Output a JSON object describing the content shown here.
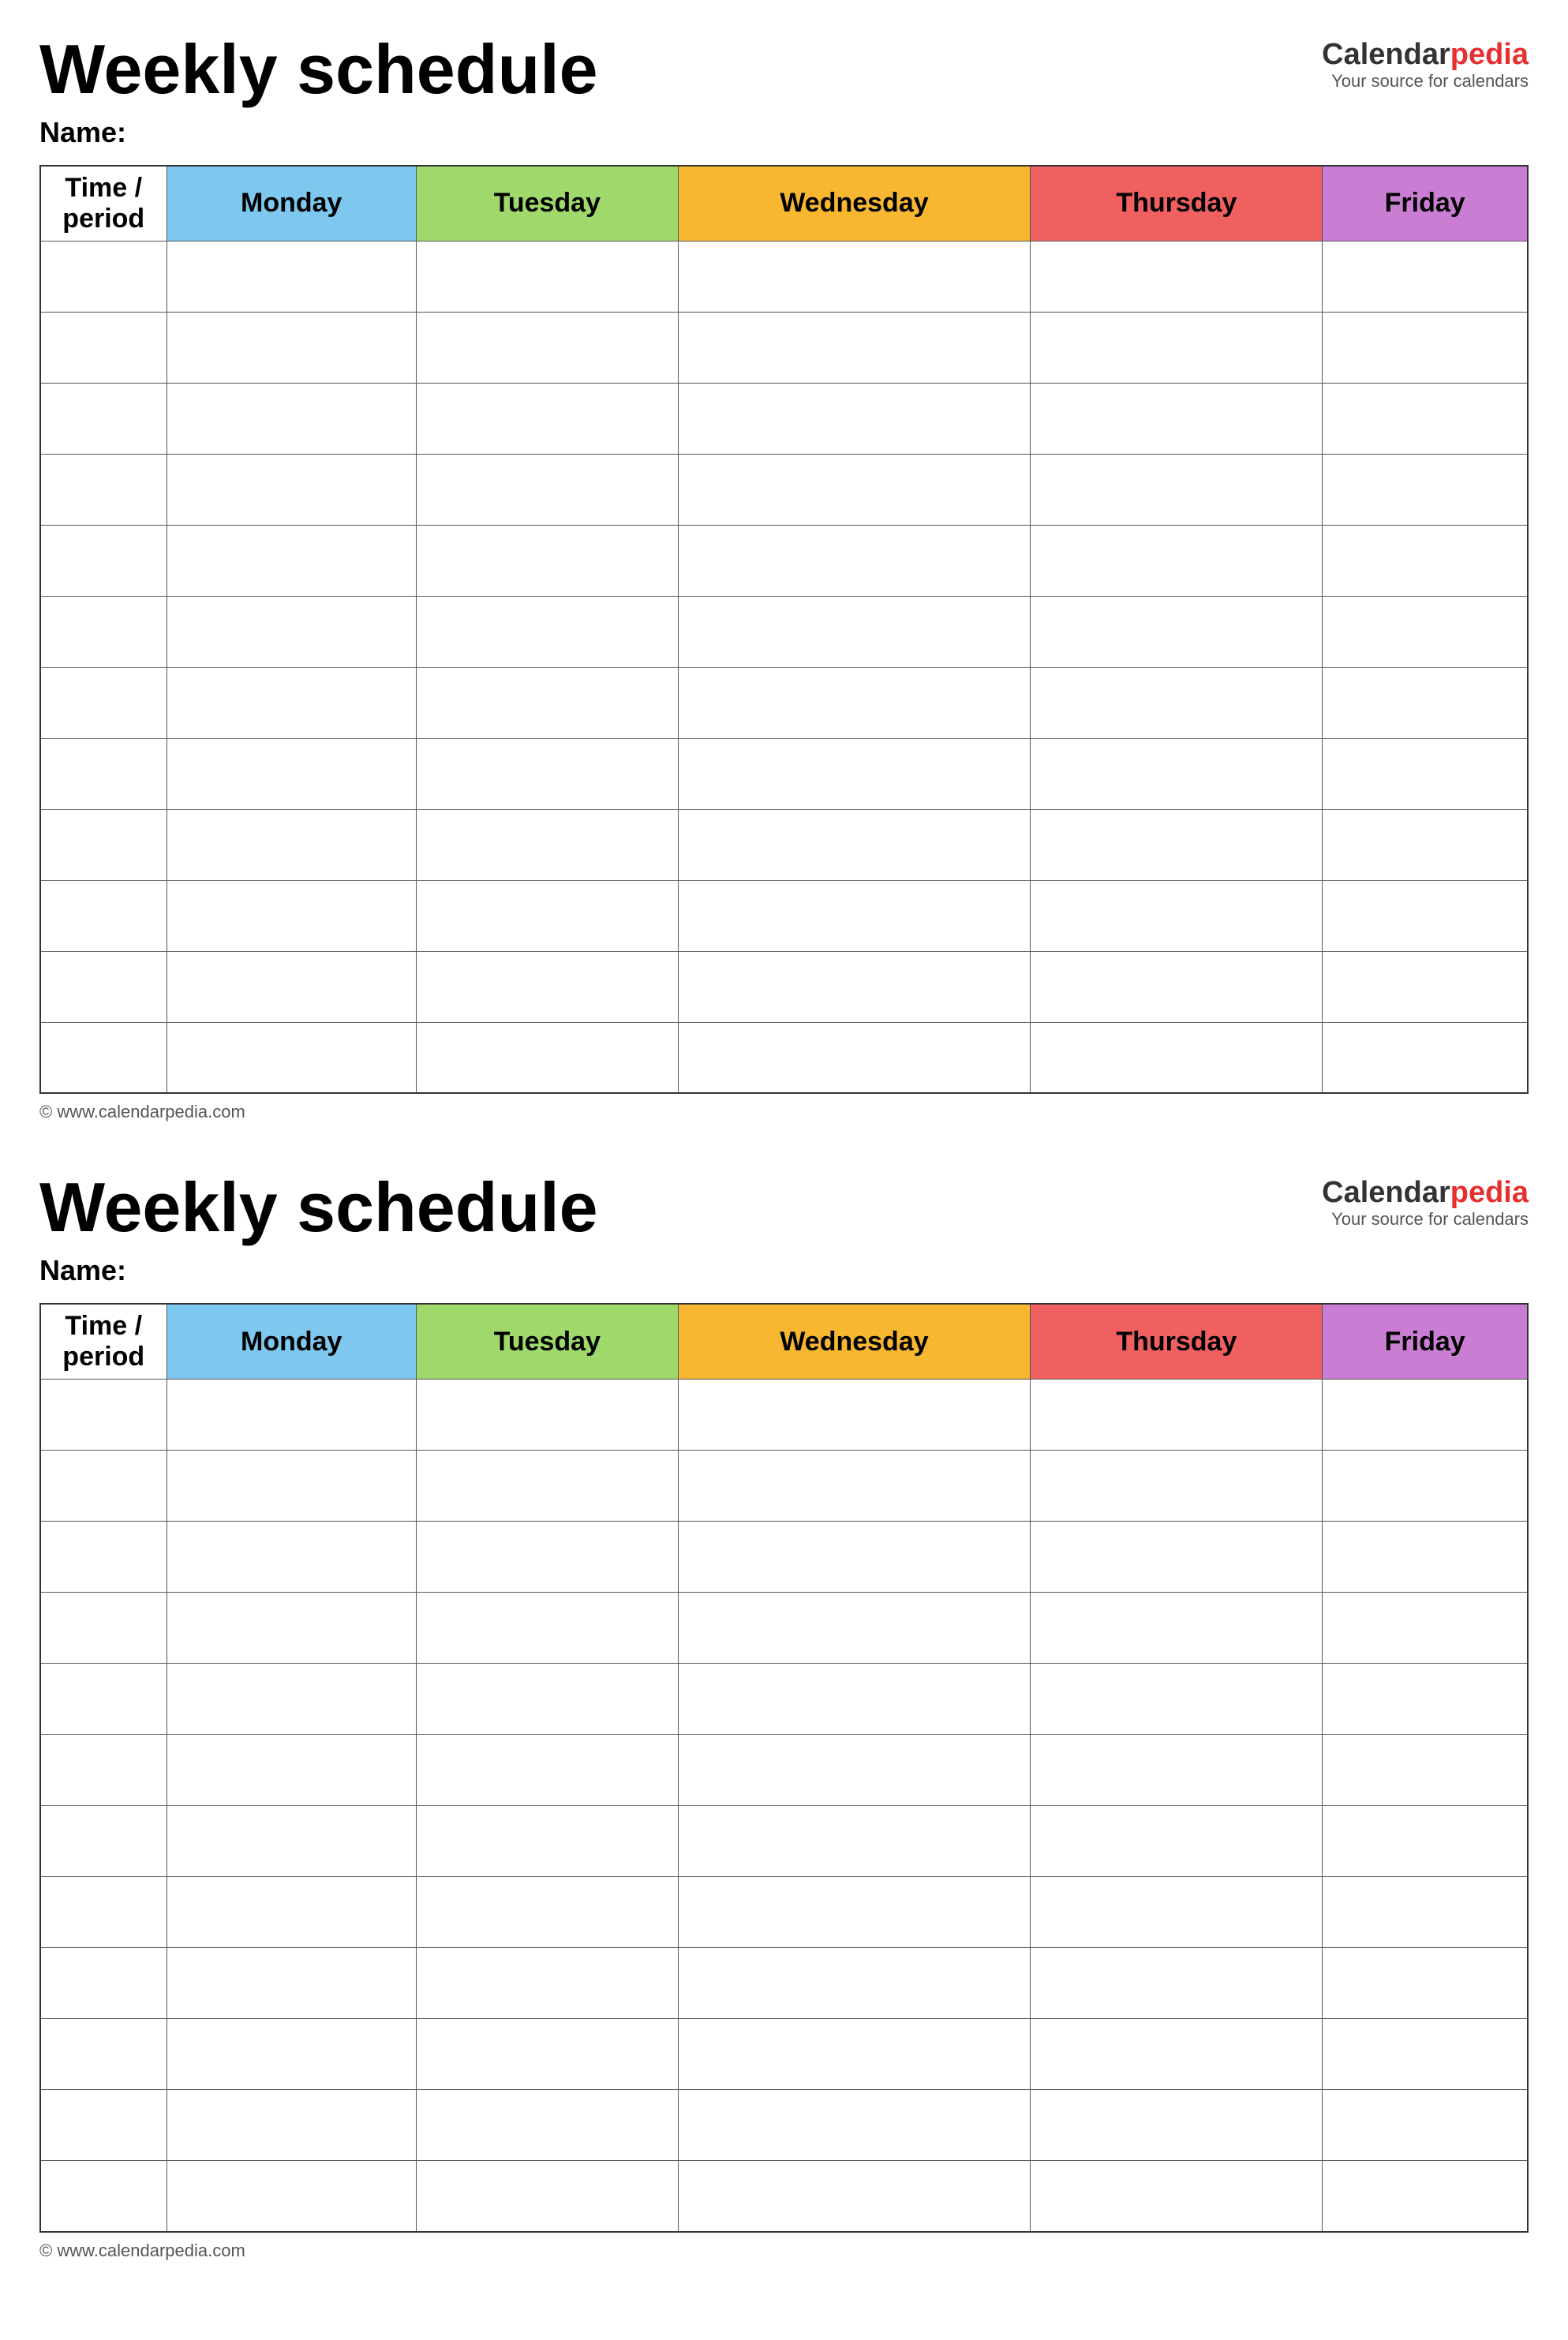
{
  "sections": [
    {
      "id": "section1",
      "title": "Weekly schedule",
      "logo": {
        "calendar": "Calendar",
        "pedia": "pedia",
        "subtitle": "Your source for calendars"
      },
      "name_label": "Name:",
      "table": {
        "columns": [
          {
            "label": "Time / period",
            "class": "col-time"
          },
          {
            "label": "Monday",
            "class": "col-monday"
          },
          {
            "label": "Tuesday",
            "class": "col-tuesday"
          },
          {
            "label": "Wednesday",
            "class": "col-wednesday"
          },
          {
            "label": "Thursday",
            "class": "col-thursday"
          },
          {
            "label": "Friday",
            "class": "col-friday"
          }
        ],
        "row_count": 12
      },
      "footer": "© www.calendarpedia.com"
    },
    {
      "id": "section2",
      "title": "Weekly schedule",
      "logo": {
        "calendar": "Calendar",
        "pedia": "pedia",
        "subtitle": "Your source for calendars"
      },
      "name_label": "Name:",
      "table": {
        "columns": [
          {
            "label": "Time / period",
            "class": "col-time"
          },
          {
            "label": "Monday",
            "class": "col-monday"
          },
          {
            "label": "Tuesday",
            "class": "col-tuesday"
          },
          {
            "label": "Wednesday",
            "class": "col-wednesday"
          },
          {
            "label": "Thursday",
            "class": "col-thursday"
          },
          {
            "label": "Friday",
            "class": "col-friday"
          }
        ],
        "row_count": 12
      },
      "footer": "© www.calendarpedia.com"
    }
  ]
}
